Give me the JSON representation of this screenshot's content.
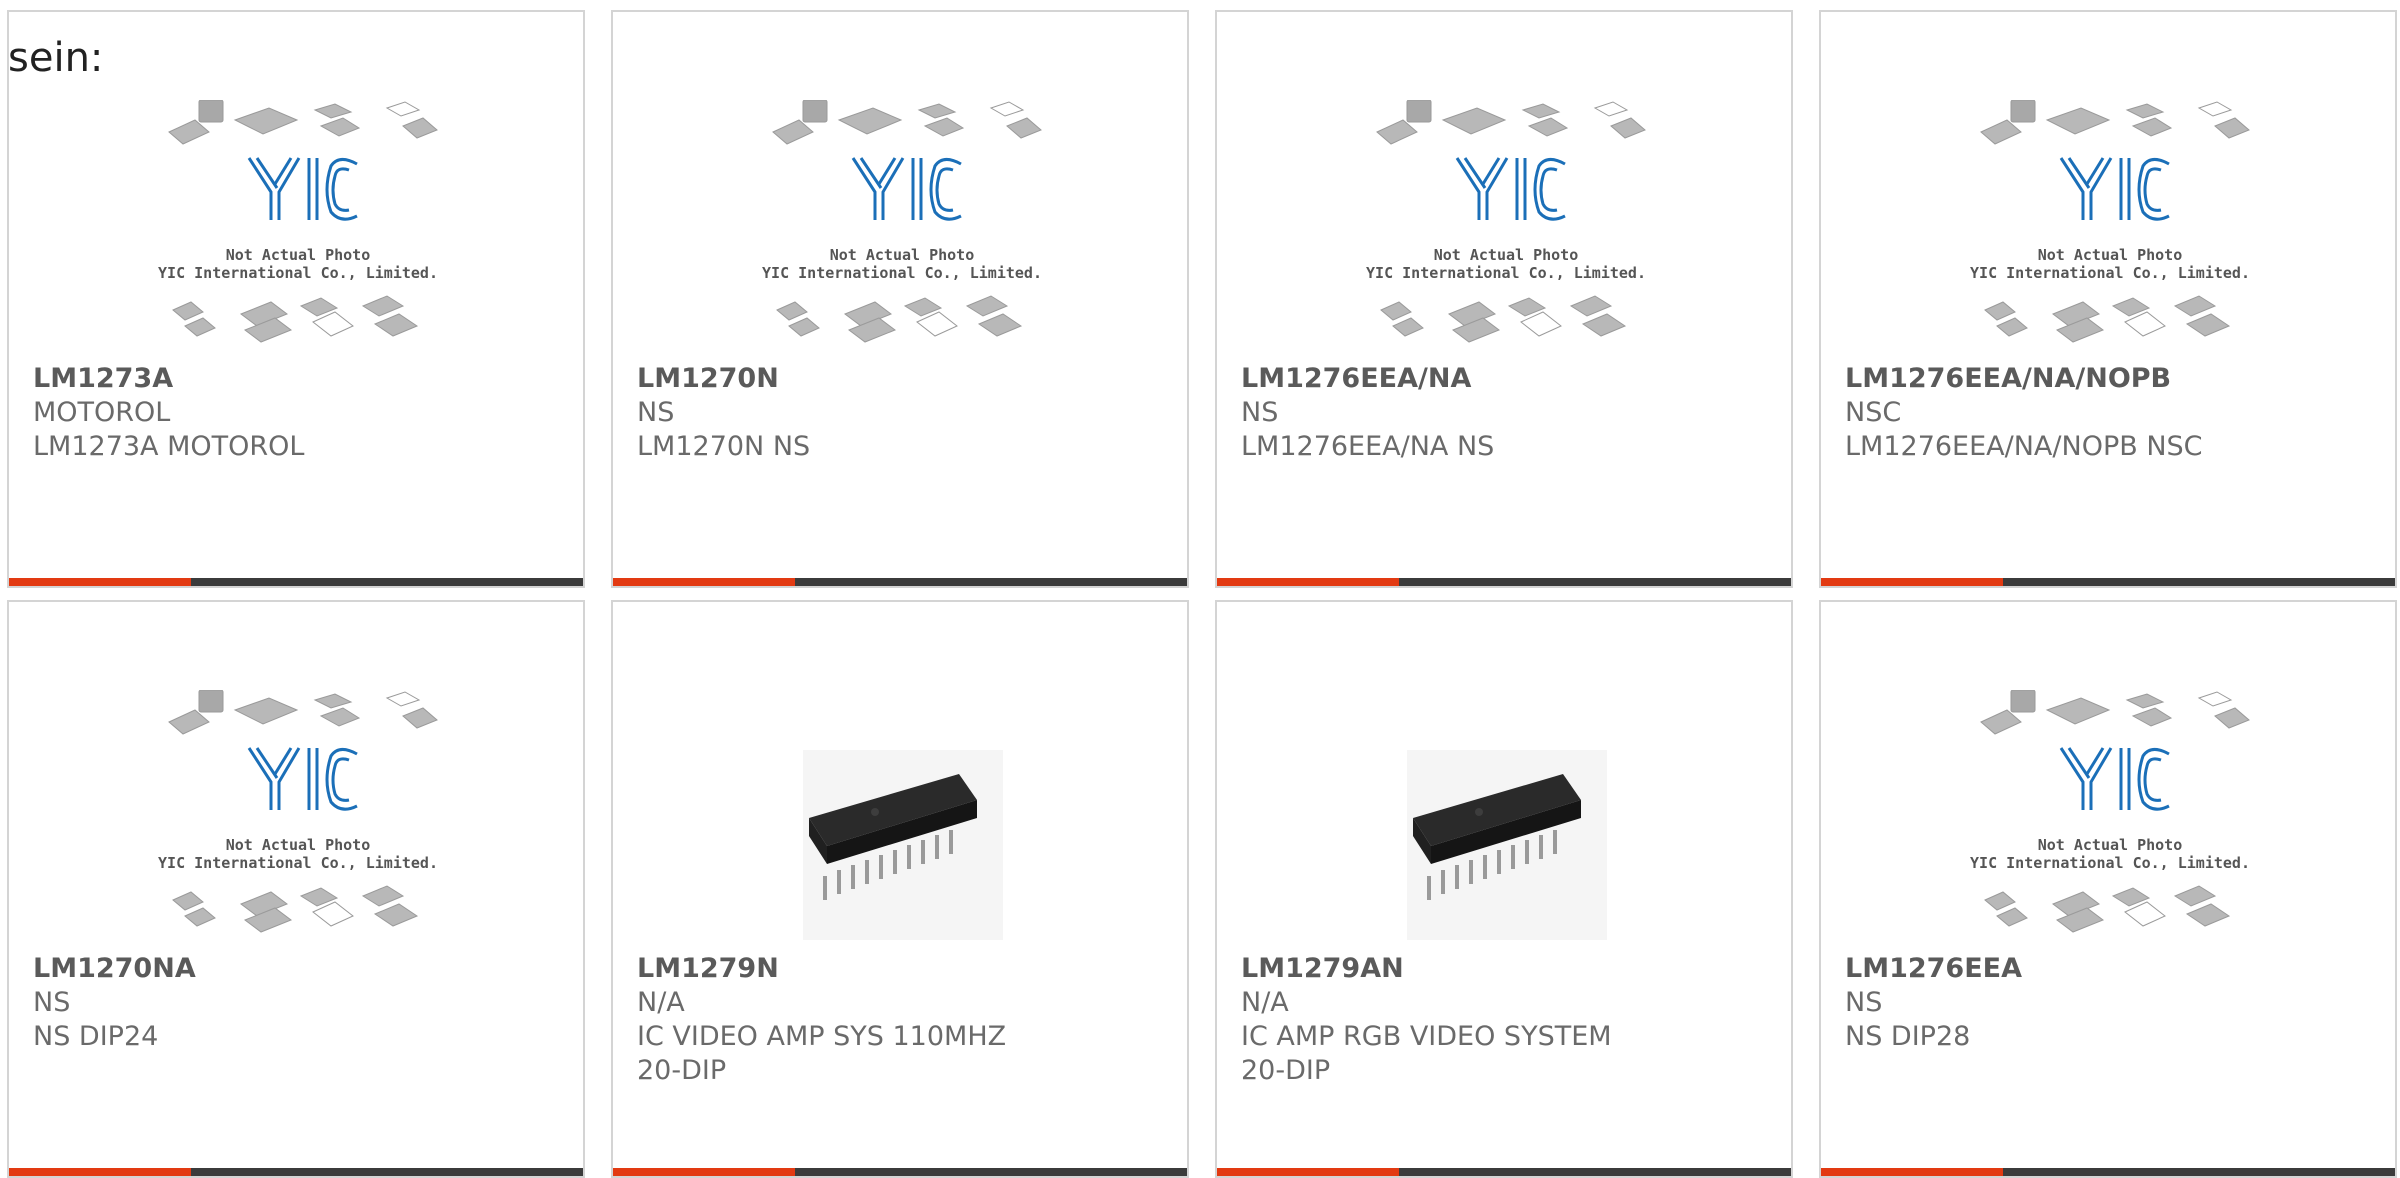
{
  "intro_text": "sein:",
  "placeholder": {
    "brand": "YIC",
    "line1": "Not Actual Photo",
    "line2": "YIC International Co., Limited."
  },
  "colors": {
    "accent": "#e23a12",
    "bar": "#3b3b3b",
    "brand_blue": "#1b6fb8"
  },
  "products": [
    {
      "part": "LM1273A",
      "mfr": "MOTOROL",
      "desc": "LM1273A MOTOROL",
      "image": "placeholder"
    },
    {
      "part": "LM1270N",
      "mfr": "NS",
      "desc": "LM1270N NS",
      "image": "placeholder"
    },
    {
      "part": "LM1276EEA/NA",
      "mfr": "NS",
      "desc": "LM1276EEA/NA NS",
      "image": "placeholder"
    },
    {
      "part": "LM1276EEA/NA/NOPB",
      "mfr": "NSC",
      "desc": "LM1276EEA/NA/NOPB NSC",
      "image": "placeholder"
    },
    {
      "part": "LM1270NA",
      "mfr": "NS",
      "desc": "NS DIP24",
      "image": "placeholder"
    },
    {
      "part": "LM1279N",
      "mfr": "N/A",
      "desc": "IC VIDEO AMP SYS 110MHZ 20-DIP",
      "image": "dip-chip"
    },
    {
      "part": "LM1279AN",
      "mfr": "N/A",
      "desc": "IC AMP RGB VIDEO SYSTEM 20-DIP",
      "image": "dip-chip"
    },
    {
      "part": "LM1276EEA",
      "mfr": "NS",
      "desc": "NS DIP28",
      "image": "placeholder"
    }
  ]
}
